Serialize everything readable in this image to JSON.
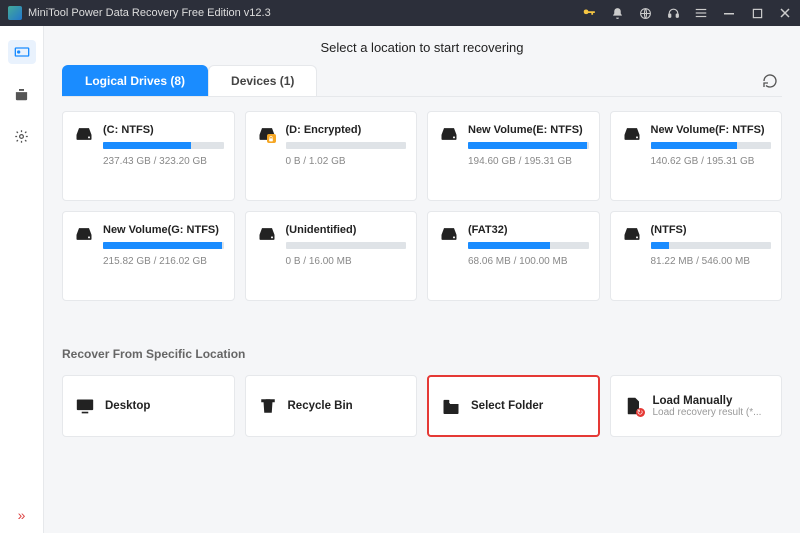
{
  "titlebar": {
    "title": "MiniTool Power Data Recovery Free Edition v12.3"
  },
  "headline": "Select a location to start recovering",
  "tabs": {
    "logical": "Logical Drives (8)",
    "devices": "Devices (1)"
  },
  "drives": [
    {
      "name": "(C: NTFS)",
      "size": "237.43 GB / 323.20 GB",
      "fill": 73,
      "locked": false
    },
    {
      "name": "(D: Encrypted)",
      "size": "0 B / 1.02 GB",
      "fill": 0,
      "locked": true
    },
    {
      "name": "New Volume(E: NTFS)",
      "size": "194.60 GB / 195.31 GB",
      "fill": 99,
      "locked": false
    },
    {
      "name": "New Volume(F: NTFS)",
      "size": "140.62 GB / 195.31 GB",
      "fill": 72,
      "locked": false
    },
    {
      "name": "New Volume(G: NTFS)",
      "size": "215.82 GB / 216.02 GB",
      "fill": 99,
      "locked": false
    },
    {
      "name": "(Unidentified)",
      "size": "0 B / 16.00 MB",
      "fill": 0,
      "locked": false
    },
    {
      "name": "(FAT32)",
      "size": "68.06 MB / 100.00 MB",
      "fill": 68,
      "locked": false
    },
    {
      "name": "(NTFS)",
      "size": "81.22 MB / 546.00 MB",
      "fill": 15,
      "locked": false
    }
  ],
  "section2_title": "Recover From Specific Location",
  "locations": {
    "desktop": "Desktop",
    "recycle": "Recycle Bin",
    "folder": "Select Folder",
    "manual_label": "Load Manually",
    "manual_sub": "Load recovery result (*..."
  }
}
